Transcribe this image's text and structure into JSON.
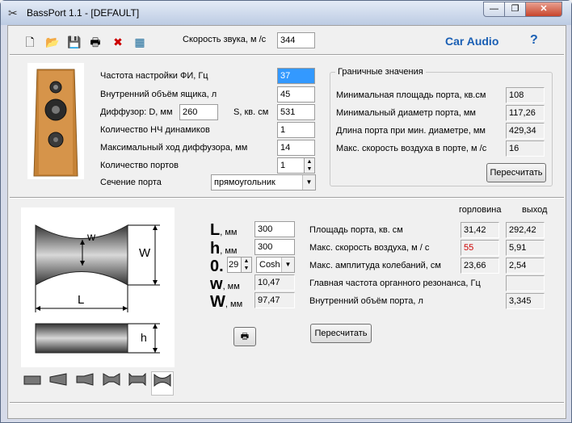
{
  "window": {
    "title": "BassPort 1.1 - [DEFAULT]",
    "min": "—",
    "max": "❐",
    "close": "✕"
  },
  "toolbar": {
    "sound_speed_label": "Скорость звука, м /с",
    "sound_speed_value": "344",
    "brand": "Car Audio",
    "help": "?"
  },
  "params": {
    "tuning_freq_label": "Частота настройки ФИ, Гц",
    "tuning_freq_value": "37",
    "box_volume_label": "Внутренний объём ящика, л",
    "box_volume_value": "45",
    "diffuser_label": "Диффузор: D, мм",
    "diffuser_value": "260",
    "area_label": "S, кв. см",
    "area_value": "531",
    "drivers_label": "Количество НЧ динамиков",
    "drivers_value": "1",
    "excursion_label": "Максимальный ход диффузора, мм",
    "excursion_value": "14",
    "ports_label": "Количество портов",
    "ports_value": "1",
    "section_label": "Сечение порта",
    "section_value": "прямоугольник"
  },
  "limits": {
    "title": "Граничные значения",
    "min_area_label": "Минимальная площадь порта, кв.см",
    "min_area_value": "108",
    "min_diam_label": "Минимальный диаметр порта, мм",
    "min_diam_value": "117,26",
    "len_label": "Длина порта при мин. диаметре, мм",
    "len_value": "429,34",
    "air_speed_label": "Макс. скорость воздуха в порте, м /с",
    "air_speed_value": "16",
    "recalc": "Пересчитать"
  },
  "diagram": {
    "w": "w",
    "W": "W",
    "L": "L",
    "h": "h"
  },
  "dims": {
    "L_letter": "L",
    "L_unit": ", мм",
    "L_value": "300",
    "h_letter": "h",
    "h_unit": ", мм",
    "h_value": "300",
    "zero_letter": "0.",
    "zero_value": "29",
    "func_value": "Cosh",
    "w_letter": "w",
    "w_unit": ", мм",
    "w_value": "10,47",
    "W_letter": "W",
    "W_unit": ", мм",
    "W_value": "97,47"
  },
  "results": {
    "col_throat": "горловина",
    "col_exit": "выход",
    "area_label": "Площадь порта, кв. см",
    "area_throat": "31,42",
    "area_exit": "292,42",
    "speed_label": "Макс. скорость воздуха, м / с",
    "speed_throat": "55",
    "speed_exit": "5,91",
    "amp_label": "Макс. амплитуда колебаний, см",
    "amp_throat": "23,66",
    "amp_exit": "2,54",
    "res_label": "Главная частота органного резонанса, Гц",
    "res_exit": "",
    "vol_label": "Внутренний объём порта, л",
    "vol_exit": "3,345",
    "recalc": "Пересчитать"
  },
  "colors": {
    "brand": "#1a5fb4",
    "warning": "#cc0000"
  }
}
